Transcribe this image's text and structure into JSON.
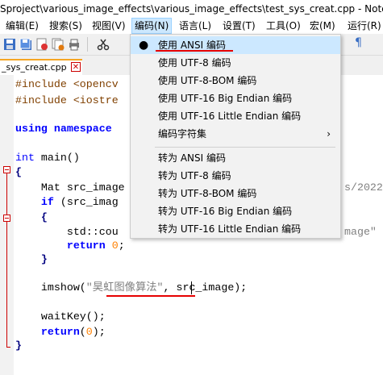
{
  "window": {
    "title": "Sproject\\various_image_effects\\various_image_effects\\test_sys_creat.cpp - Notepad++"
  },
  "menubar": {
    "items": [
      "编辑(E)",
      "搜索(S)",
      "视图(V)",
      "编码(N)",
      "语言(L)",
      "设置(T)",
      "工具(O)",
      "宏(M)",
      "运行(R)"
    ]
  },
  "tab": {
    "label": "_sys_creat.cpp",
    "close": "✕"
  },
  "toolbar": {
    "icons": [
      "save-icon",
      "save-all-icon",
      "close-icon",
      "close-all-icon",
      "print-icon",
      "cut-icon",
      "pilcrow-icon"
    ],
    "pilcrow": "¶"
  },
  "code": {
    "line1_pp": "#include <opencv",
    "line2_pp": "#include <iostre",
    "line4_kw1": "using",
    "line4_kw2": "namespace",
    "line6_kw": "int",
    "line6_rest": " main()",
    "line7": "{",
    "line8": "    Mat src_image",
    "line8_tail": "s/2022",
    "line9_kw": "    if",
    "line9_rest": " (src_imag",
    "line10": "    {",
    "line11": "        std::cou",
    "line11_tail": "mage\"",
    "line12_kw": "        return",
    "line12_num": "0",
    "line12_rest": ";",
    "line13": "    }",
    "line15_a": "    imshow(",
    "line15_str": "\"昊虹图像算法\"",
    "line15_b": ", src_image);",
    "line17_a": "    waitKey();",
    "line18_kw": "    return",
    "line18_a": "(",
    "line18_num": "0",
    "line18_b": ");",
    "line19": "}"
  },
  "encoding_menu": {
    "items": [
      {
        "label": "使用 ANSI 编码",
        "checked": true
      },
      {
        "label": "使用 UTF-8 编码"
      },
      {
        "label": "使用 UTF-8-BOM 编码"
      },
      {
        "label": "使用 UTF-16 Big Endian 编码"
      },
      {
        "label": "使用 UTF-16 Little Endian 编码"
      },
      {
        "label": "编码字符集",
        "submenu": true
      },
      {
        "label": "转为 ANSI 编码"
      },
      {
        "label": "转为 UTF-8 编码"
      },
      {
        "label": "转为 UTF-8-BOM 编码"
      },
      {
        "label": "转为 UTF-16 Big Endian 编码"
      },
      {
        "label": "转为 UTF-16 Little Endian 编码"
      }
    ],
    "bullet": "●",
    "arrow": "›"
  },
  "colors": {
    "accent": "#cce8ff",
    "annotation": "#e60000",
    "tab_marker": "#f5a623"
  }
}
